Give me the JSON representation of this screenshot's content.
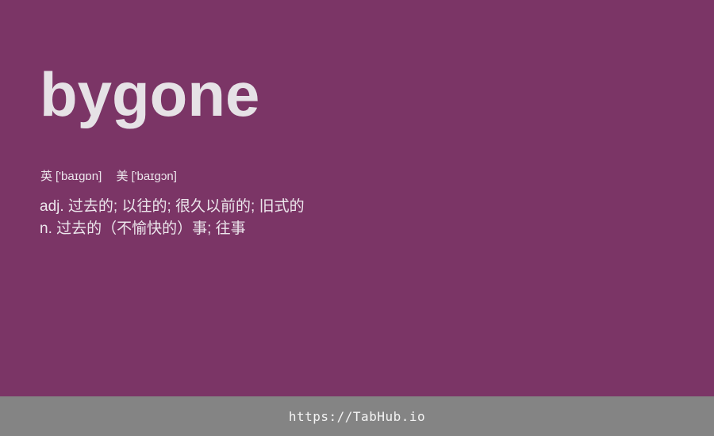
{
  "card": {
    "word": "bygone",
    "phonetics": {
      "uk_label": "英",
      "uk_ipa": "['baɪɡɒn]",
      "us_label": "美",
      "us_ipa": "['baɪɡɔn]"
    },
    "definitions": [
      "adj. 过去的; 以往的; 很久以前的; 旧式的",
      "n. 过去的（不愉快的）事; 往事"
    ]
  },
  "footer": {
    "link_text": "https://TabHub.io"
  },
  "colors": {
    "background": "#7b3566",
    "footer_background": "#848484",
    "text": "#e6e2e6"
  }
}
